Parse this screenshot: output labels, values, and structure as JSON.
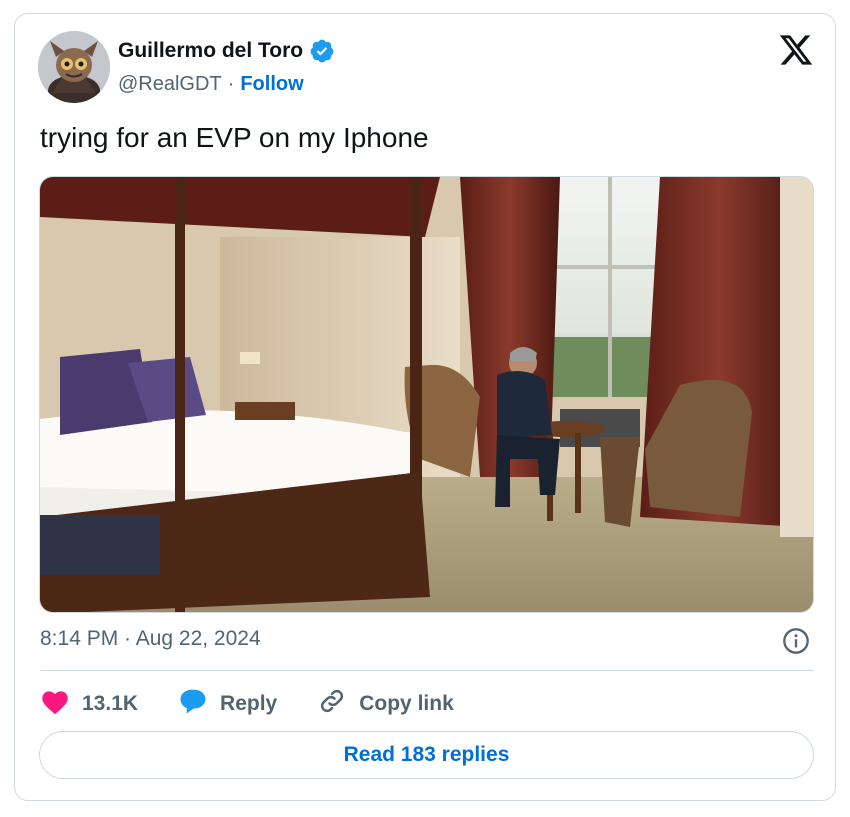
{
  "author": {
    "name": "Guillermo del Toro",
    "handle": "@RealGDT",
    "separator": "·",
    "follow_label": "Follow"
  },
  "tweet": {
    "text": "trying for an EVP on my Iphone",
    "timestamp": "8:14 PM · Aug 22, 2024"
  },
  "actions": {
    "likes_count": "13.1K",
    "reply_label": "Reply",
    "copy_link_label": "Copy link"
  },
  "read_replies_label": "Read 183 replies",
  "colors": {
    "accent": "#006fd6",
    "like": "#f91880",
    "reply": "#1d9bf0",
    "muted": "#536471",
    "border": "#cfd9de"
  },
  "icons": [
    "verified-badge-icon",
    "x-logo-icon",
    "info-icon",
    "heart-icon",
    "reply-bubble-icon",
    "link-icon"
  ]
}
